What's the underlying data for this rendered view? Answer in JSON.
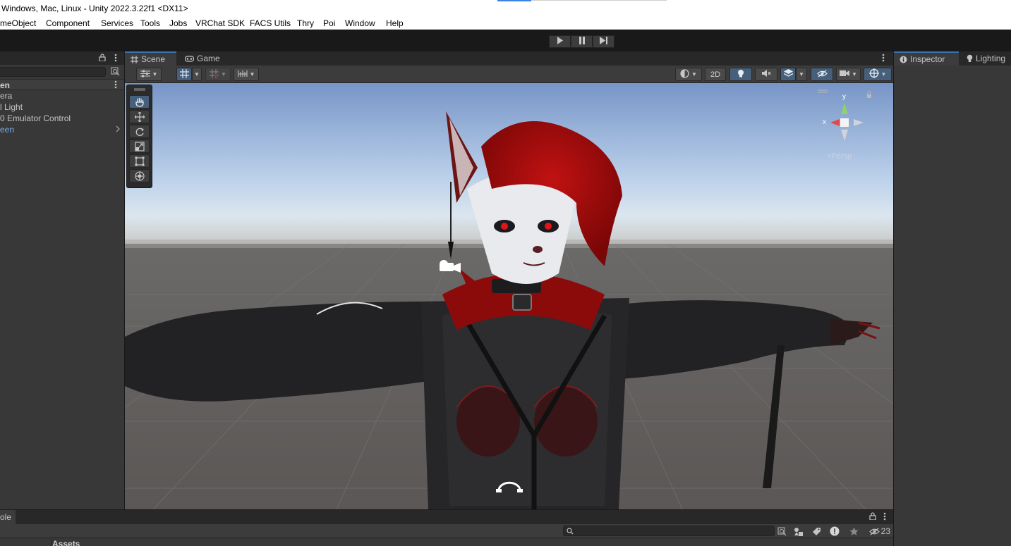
{
  "window": {
    "title": "Windows, Mac, Linux - Unity 2022.3.22f1 <DX11>"
  },
  "menu": [
    {
      "label": "meObject"
    },
    {
      "label": "Component"
    },
    {
      "label": "Services"
    },
    {
      "label": "Tools"
    },
    {
      "label": "Jobs"
    },
    {
      "label": "VRChat SDK"
    },
    {
      "label": "FACS Utils"
    },
    {
      "label": "Thry"
    },
    {
      "label": "Poi"
    },
    {
      "label": "Window"
    },
    {
      "label": "Help"
    }
  ],
  "toolbar": {
    "play_icon": "play-icon",
    "pause_icon": "pause-icon",
    "step_icon": "step-icon"
  },
  "hierarchy": {
    "scene_name": "en",
    "items": [
      {
        "label": "era",
        "prefab": false
      },
      {
        "label": "l Light",
        "prefab": false
      },
      {
        "label": "0 Emulator Control",
        "prefab": false
      },
      {
        "label": "een",
        "prefab": true
      }
    ]
  },
  "scene_view": {
    "tabs": [
      {
        "label": "Scene",
        "icon": "grid-icon",
        "active": true
      },
      {
        "label": "Game",
        "icon": "gamepad-icon",
        "active": false
      }
    ],
    "toolbar": {
      "two_d_label": "2D"
    },
    "gizmo": {
      "y_label": "y",
      "x_label": "x",
      "projection_label": "Persp"
    },
    "tools": [
      "hand-tool-icon",
      "move-tool-icon",
      "rotate-tool-icon",
      "scale-tool-icon",
      "rect-tool-icon",
      "transform-tool-icon"
    ]
  },
  "inspector": {
    "tabs": [
      {
        "label": "Inspector",
        "icon": "info-icon"
      },
      {
        "label": "Lighting",
        "icon": "lightbulb-icon"
      }
    ]
  },
  "bottom": {
    "console_label": "ole",
    "assets_label": "Assets",
    "hidden_count": "23"
  },
  "colors": {
    "panel": "#383838",
    "tab_strip": "#282828",
    "accent": "#3a72b0",
    "prefab_text": "#7bafea"
  }
}
